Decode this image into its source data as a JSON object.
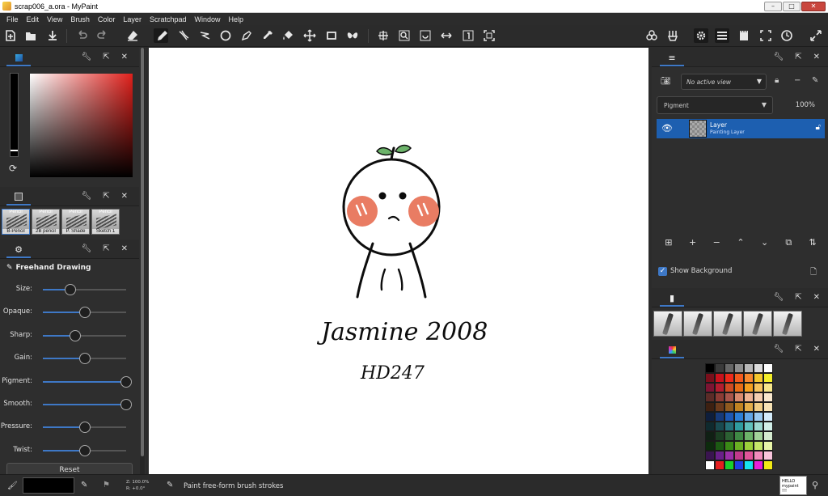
{
  "window": {
    "title": "scrap006_a.ora - MyPaint",
    "min": "–",
    "max": "□",
    "close": "✕"
  },
  "menu": [
    "File",
    "Edit",
    "View",
    "Brush",
    "Color",
    "Layer",
    "Scratchpad",
    "Window",
    "Help"
  ],
  "toolbar_icons": [
    "new-icon",
    "open-icon",
    "save-icon",
    "undo-icon",
    "redo-icon",
    "eraser-icon",
    "freehand-icon",
    "inking-icon",
    "lasso-icon",
    "ellipse-icon",
    "pen-icon",
    "color-picker-icon",
    "fill-icon",
    "move-icon",
    "frame-icon",
    "symmetry-icon",
    "pan-icon",
    "zoom-icon",
    "rotate-icon",
    "flip-icon",
    "reset-view-icon",
    "fit-view-icon",
    "brushes-icon",
    "brush-settings-icon",
    "settings-icon",
    "menu-icon",
    "scratchpad-icon",
    "fullscreen-icon",
    "clock-icon",
    "expand-icon"
  ],
  "left_panel": {
    "brush_name": "Freehand Drawing",
    "brushes": [
      {
        "label": "B-Pencil"
      },
      {
        "label": "2B pencil"
      },
      {
        "label": "P. Shade"
      },
      {
        "label": "Sketch 1"
      }
    ],
    "brush_tab_labels": [
      "Pencil",
      "Pencil",
      "Pencil",
      "Pencil"
    ],
    "sliders": [
      {
        "label": "Size:",
        "value": 0.33
      },
      {
        "label": "Opaque:",
        "value": 0.5
      },
      {
        "label": "Sharp:",
        "value": 0.39
      },
      {
        "label": "Gain:",
        "value": 0.5
      },
      {
        "label": "Pigment:",
        "value": 1.0
      },
      {
        "label": "Smooth:",
        "value": 1.0
      },
      {
        "label": "Pressure:",
        "value": 0.5
      },
      {
        "label": "Twist:",
        "value": 0.5
      }
    ],
    "reset_label": "Reset"
  },
  "canvas": {
    "text1": "Jasmine 2008",
    "text2": "HD247"
  },
  "right_panel": {
    "view_placeholder": "No active view",
    "blend_mode": "Pigment",
    "opacity": "100%",
    "layer_name": "Layer",
    "layer_type": "Painting Layer",
    "show_background": "Show Background"
  },
  "palette_colors": [
    "#000000",
    "#3a3a3a",
    "#666666",
    "#8f8f8f",
    "#b8b8b8",
    "#dcdcdc",
    "#ffffff",
    "#7a0f1b",
    "#c9121c",
    "#ee2a1a",
    "#f25a1d",
    "#f7892f",
    "#f5c82e",
    "#f3ee2a",
    "#7c1432",
    "#b31c2e",
    "#d04b21",
    "#e86d15",
    "#f5a01f",
    "#f6c55e",
    "#f6e68b",
    "#5b2b27",
    "#8b3b34",
    "#a8554a",
    "#d98a6e",
    "#eeb393",
    "#f5cfb1",
    "#f9e8cf",
    "#3d2011",
    "#6a3a1c",
    "#8f5a1f",
    "#c08322",
    "#e2ad4a",
    "#f0cd85",
    "#f7e3b5",
    "#0e1e3c",
    "#163a7a",
    "#1d58b3",
    "#2c7fd6",
    "#62a6e6",
    "#9ccbf1",
    "#d4ecfb",
    "#0f2a2e",
    "#194a50",
    "#257179",
    "#2f9c9f",
    "#61c1bd",
    "#9ed9d2",
    "#d2efe9",
    "#102014",
    "#1b3d22",
    "#2c6133",
    "#3f8a45",
    "#6cb36a",
    "#a3d39b",
    "#d5ecd0",
    "#0d2b0d",
    "#1c5a13",
    "#3a8a16",
    "#6bb023",
    "#9ccf3b",
    "#c6e66a",
    "#e9f6a9",
    "#3a1450",
    "#6a1f8a",
    "#9a2fa8",
    "#c0398c",
    "#e0559a",
    "#f08cbc",
    "#f8c5dc",
    "#ffffff",
    "#e41f1f",
    "#18d12a",
    "#1f3fe4",
    "#17e3ee",
    "#e81fd9",
    "#f2ea15"
  ],
  "status": {
    "message": "Paint free-form brush strokes",
    "zoom": "Z: 100.0%",
    "rotation": "R: +0.0°",
    "preview_text": "HELLO mypaint !!!"
  }
}
